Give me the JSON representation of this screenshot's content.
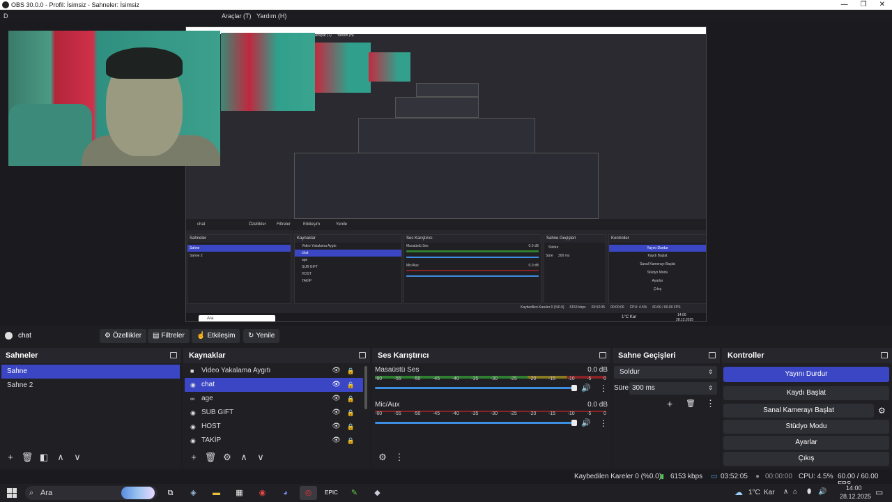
{
  "window": {
    "title": "OBS 30.0.0 - Profil: İsimsiz - Sahneler: İsimsiz",
    "min": "—",
    "max": "❐",
    "close": "✕"
  },
  "menu": {
    "d": "D",
    "tools": "Araçlar (T)",
    "help": "Yardım (H)"
  },
  "properties_bar": {
    "source_name": "chat",
    "properties": "Özellikler",
    "filters": "Filtreler",
    "interact": "Etkileşim",
    "refresh": "Yenile"
  },
  "scenes": {
    "title": "Sahneler",
    "items": [
      {
        "label": "Sahne",
        "selected": true
      },
      {
        "label": "Sahne 2",
        "selected": false
      }
    ]
  },
  "sources": {
    "title": "Kaynaklar",
    "items": [
      {
        "label": "Video Yakalama Aygıtı",
        "icon": "camera-icon",
        "selected": false
      },
      {
        "label": "chat",
        "icon": "globe-icon",
        "selected": true
      },
      {
        "label": "age",
        "icon": "link-icon",
        "selected": false
      },
      {
        "label": "SUB GIFT",
        "icon": "globe-icon",
        "selected": false
      },
      {
        "label": "HOST",
        "icon": "globe-icon",
        "selected": false
      },
      {
        "label": "TAKİP",
        "icon": "globe-icon",
        "selected": false
      }
    ]
  },
  "mixer": {
    "title": "Ses Karıştırıcı",
    "channels": [
      {
        "name": "Masaüstü Ses",
        "db": "0.0 dB"
      },
      {
        "name": "Mic/Aux",
        "db": "0.0 dB"
      }
    ],
    "ticks": [
      "-60",
      "-55",
      "-50",
      "-45",
      "-40",
      "-35",
      "-30",
      "-25",
      "-20",
      "-15",
      "-10",
      "-5",
      "0"
    ]
  },
  "transitions": {
    "title": "Sahne Geçişleri",
    "type": "Soldur",
    "duration_label": "Süre",
    "duration": "300 ms"
  },
  "controls": {
    "title": "Kontroller",
    "stop_stream": "Yayını Durdur",
    "start_recording": "Kaydı Başlat",
    "virtual_cam": "Sanal Kamerayı Başlat",
    "studio_mode": "Stüdyo Modu",
    "settings": "Ayarlar",
    "exit": "Çıkış"
  },
  "status": {
    "dropped": "Kaybedilen Kareler 0 (%0.0)",
    "bitrate": "6153 kbps",
    "stream_time": "03:52:05",
    "rec_time": "00:00:00",
    "cpu": "CPU: 4.5%",
    "fps": "60.00 / 60.00 FPS"
  },
  "nested": {
    "bar_source": "chat",
    "btn_props": "Özellikler",
    "btn_filters": "Filtreler",
    "btn_interact": "Etkileşim",
    "btn_refresh": "Yenile",
    "scenes_title": "Sahneler",
    "sources_title": "Kaynaklar",
    "mixer_title": "Ses Karıştırıcı",
    "trans_title": "Sahne Geçişleri",
    "ctl_title": "Kontroller",
    "scene1": "Sahne",
    "scene2": "Sahne 2",
    "trans_type": "Soldur",
    "trans_dur_label": "Süre",
    "trans_dur": "300 ms",
    "desk_audio": "Masaüstü Ses",
    "mic": "Mic/Aux",
    "db": "0.0 dB",
    "ctl_stop": "Yayını Durdur",
    "ctl_rec": "Kaydı Başlat",
    "ctl_vcam": "Sanal Kamerayı Başlat",
    "ctl_studio": "Stüdyo Modu",
    "ctl_settings": "Ayarlar",
    "ctl_exit": "Çıkış",
    "src1": "Video Yakalama Aygıtı",
    "src2": "chat",
    "src3": "age",
    "src4": "SUB GIFT",
    "src5": "HOST",
    "src6": "TAKİP",
    "status_dropped": "Kaybedilen Kareler 0 (%0.0)",
    "status_bitrate": "6153 kbps",
    "status_time": "03:52:05",
    "status_rec": "00:00:00",
    "status_cpu": "CPU: 4.5%",
    "status_fps": "60.00 / 60.00 FPS",
    "task_search": "Ara",
    "task_weather": "1°C Kar",
    "task_time": "14:00",
    "task_date": "28.12.2025",
    "menu_tools": "Araçlar (T)",
    "menu_help": "Yardım (H)"
  },
  "taskbar": {
    "search": "Ara",
    "weather": "1°C",
    "weather_desc": "Kar",
    "time": "14:00",
    "date": "28.12.2025"
  },
  "colors": {
    "accent": "#3b46c4",
    "panel": "#1f1f24",
    "header": "#26262c"
  }
}
